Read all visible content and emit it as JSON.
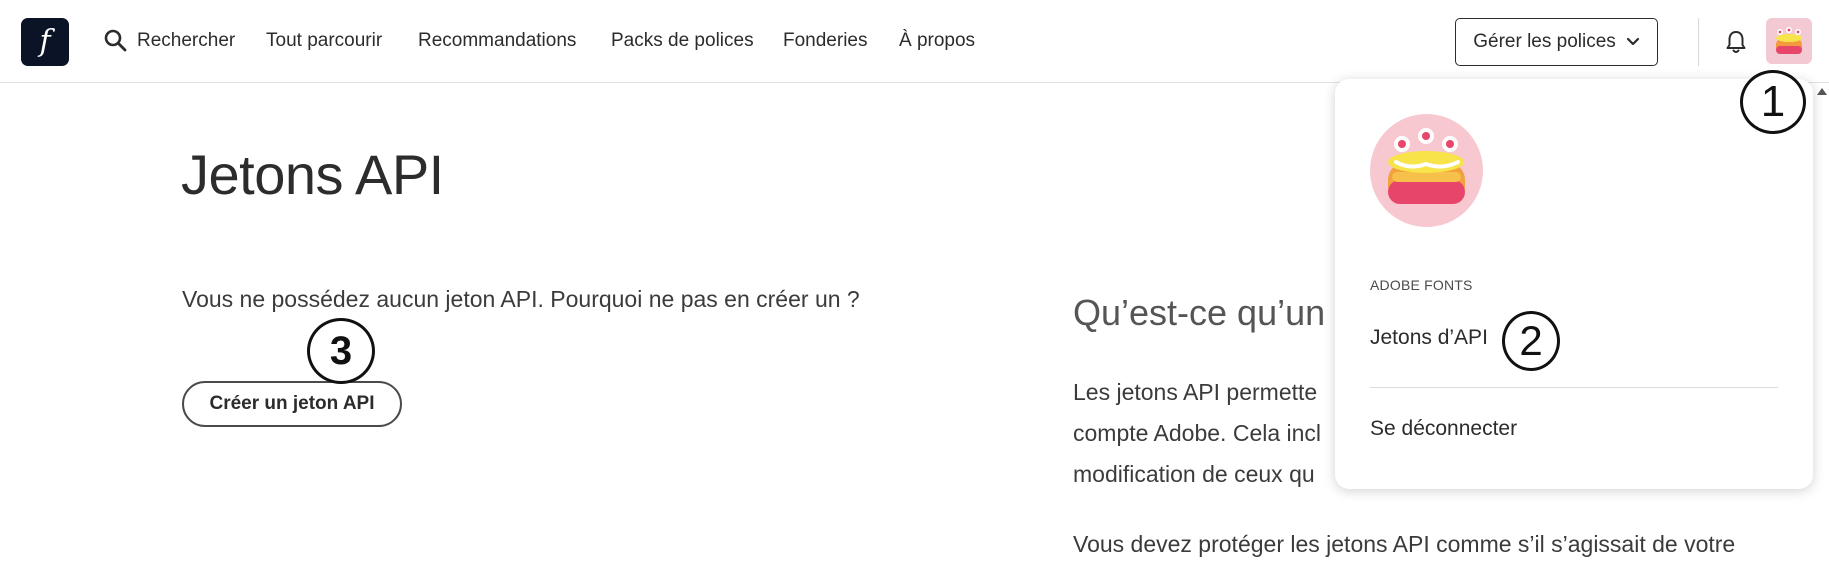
{
  "nav": {
    "logo_letter": "f",
    "search_label": "Rechercher",
    "items": [
      "Tout parcourir",
      "Recommandations",
      "Packs de polices",
      "Fonderies",
      "À propos"
    ],
    "manage_label": "Gérer les polices"
  },
  "main": {
    "title": "Jetons API",
    "empty_message": "Vous ne possédez aucun jeton API. Pourquoi ne pas en créer un ?",
    "create_button": "Créer un jeton API",
    "info_heading": "Qu’est-ce qu’un",
    "info_lines": [
      "Les jetons API permette",
      "compte Adobe. Cela incl",
      "modification de ceux qu",
      "Vous devez protéger les jetons API comme s’il s’agissait de votre"
    ]
  },
  "dropdown": {
    "section_label": "ADOBE FONTS",
    "api_tokens": "Jetons d’API",
    "sign_out": "Se déconnecter"
  },
  "annotations": [
    "1",
    "2",
    "3"
  ],
  "colors": {
    "logo_bg": "#0b1426",
    "text": "#2c2c2c",
    "avatar_bg": "#f7c8cf"
  }
}
